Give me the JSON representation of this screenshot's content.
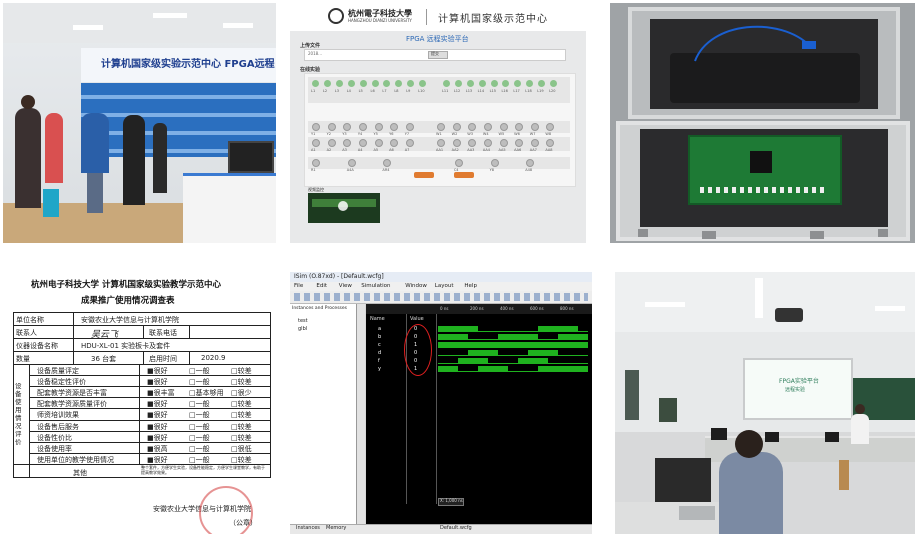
{
  "panels": {
    "lab": {
      "banner": "计算机国家级实验示范中心 FPGA远程"
    },
    "website": {
      "header_school": "杭州電子科技大學",
      "header_school_en": "HANGZHOU DIANZI UNIVERSITY",
      "header_center": "计算机国家级示范中心",
      "subtitle": "FPGA 远程实验平台",
      "section_upload": "上传文件",
      "section_online": "在线实验",
      "section_video": "视频监控",
      "file_label": "2018...",
      "btn_label": "提交",
      "led_row1": [
        "L1",
        "L2",
        "L3",
        "L4",
        "L5",
        "L6",
        "L7",
        "L8",
        "L9",
        "L10",
        "",
        "L11",
        "L12",
        "L13",
        "L14",
        "L15",
        "L16",
        "L17",
        "L18",
        "L19",
        "L20"
      ],
      "led_row2": [
        "Y1",
        "Y2",
        "Y3",
        "Y4",
        "Y5",
        "Y6",
        "Y7",
        "",
        "W1",
        "W2",
        "W3",
        "W4",
        "W5",
        "W6",
        "W7",
        "W8"
      ],
      "led_row3": [
        "A1",
        "A2",
        "A3",
        "A4",
        "A5",
        "A6",
        "A7",
        "",
        "AA1",
        "AA2",
        "AA3",
        "AA4",
        "AA5",
        "AA6",
        "AA7",
        "AA8"
      ],
      "btn_row": [
        "R1",
        "A4A",
        "AR4",
        "",
        "C4",
        "Y8",
        "A48"
      ]
    },
    "form": {
      "title_line1": "杭州电子科技大学  计算机国家级实验教学示范中心",
      "title_line2": "成果推广使用情况调查表",
      "rows": [
        {
          "label": "单位名称",
          "value": "安徽农业大学信息与计算机学院"
        },
        {
          "label": "联系人",
          "value": "吴云飞",
          "label2": "联系电话"
        },
        {
          "label": "仪器设备名称",
          "value": "HDU-XL-01 实验板卡及套件"
        },
        {
          "label": "数量",
          "value": "36 台套",
          "label2": "启用时间",
          "value2": "2020.9"
        }
      ],
      "side_label": "设备使用情况评价",
      "eval": [
        {
          "item": "设备质量评定",
          "opts": [
            "■很好",
            "□一般",
            "□较差"
          ]
        },
        {
          "item": "设备稳定性评价",
          "opts": [
            "■很好",
            "□一般",
            "□较差"
          ]
        },
        {
          "item": "配套教学资源是否丰富",
          "opts": [
            "■很丰富",
            "□基本够用",
            "□很少"
          ]
        },
        {
          "item": "配套教学资源质量评价",
          "opts": [
            "■很好",
            "□一般",
            "□较差"
          ]
        },
        {
          "item": "师资培训效果",
          "opts": [
            "■很好",
            "□一般",
            "□较差"
          ]
        },
        {
          "item": "设备售后服务",
          "opts": [
            "■很好",
            "□一般",
            "□较差"
          ]
        },
        {
          "item": "设备性价比",
          "opts": [
            "■很好",
            "□一般",
            "□较差"
          ]
        },
        {
          "item": "设备使用率",
          "opts": [
            "■很高",
            "□一般",
            "□很低"
          ]
        },
        {
          "item": "使用单位的教学使用情况",
          "opts": [
            "■很好",
            "□一般",
            "□较差"
          ]
        }
      ],
      "other_label": "其他",
      "other_text": "整个套件，方便学生实验，设备性能稳定，方便学生课堂教学，有助于提高教学效果。",
      "footer": "安徽农业大学信息与计算机学院",
      "seal": "（公章）"
    },
    "simulator": {
      "title": "ISim (O.87xd) - [Default.wcfg]",
      "menu": [
        "File",
        "Edit",
        "View",
        "Simulation",
        "Window",
        "Layout",
        "Help"
      ],
      "instances_header": "Instances and Processes",
      "tree": [
        "test",
        "glbl"
      ],
      "col_name": "Name",
      "col_value": "Value",
      "signals": [
        "a",
        "b",
        "c",
        "d",
        "f",
        "y"
      ],
      "values": [
        "0",
        "0",
        "1",
        "0",
        "0",
        "1"
      ],
      "ticks": [
        "0 ns",
        "200 ns",
        "400 ns",
        "600 ns",
        "800 ns"
      ],
      "cursor": "X: 1,000 ns",
      "tab1": "Instances",
      "tab2": "Memory",
      "tab3": "Default.wcfg"
    },
    "classroom": {
      "screen_title": "FPGA实验平台",
      "screen_sub": "远程实验"
    }
  }
}
